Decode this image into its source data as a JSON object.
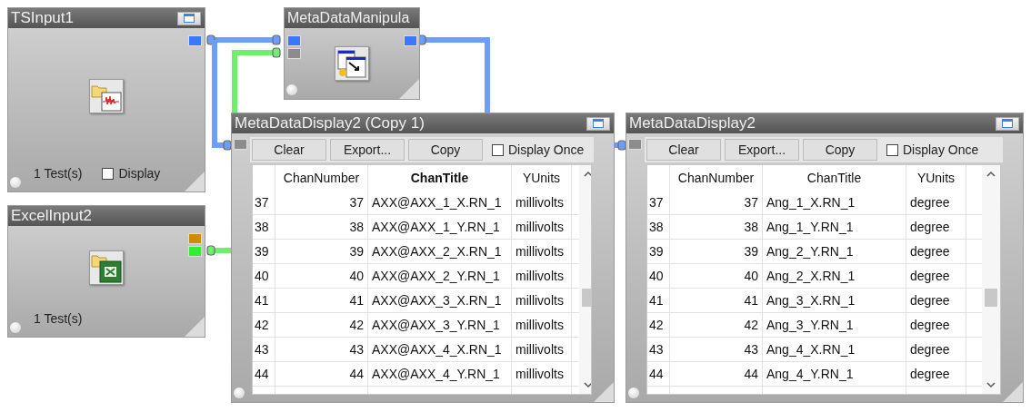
{
  "nodes": [
    {
      "kind": "input",
      "title": "TSInput1",
      "window_button": true,
      "outputs": [
        {
          "color": "#3a78ff"
        }
      ],
      "count": "1 Test(s)",
      "display": {
        "label": "Display",
        "checked": false
      }
    },
    {
      "kind": "manipulator",
      "title": "MetaDataManipula",
      "window_button": false,
      "inputs": [
        {
          "color": "#3a78ff"
        },
        {
          "color": "#8c8c8c"
        }
      ],
      "outputs": [
        {
          "color": "#3a78ff"
        }
      ]
    },
    {
      "kind": "input",
      "title": "ExcelInput2",
      "window_button": false,
      "outputs": [
        {
          "color": "#d08c00"
        },
        {
          "color": "#33ee33"
        }
      ],
      "count": "1 Test(s)"
    },
    {
      "kind": "display",
      "title": "MetaDataDisplay2 (Copy 1)",
      "window_button": true,
      "inputs": [
        {
          "color": "#8c8c8c"
        }
      ],
      "buttons": [
        "Clear",
        "Export...",
        "Copy"
      ],
      "display_once": {
        "label": "Display Once",
        "checked": false
      },
      "table": {
        "columns": [
          {
            "label": "ChanNumber",
            "selected": false
          },
          {
            "label": "ChanTitle",
            "selected": true
          },
          {
            "label": "YUnits",
            "selected": false
          }
        ],
        "rows": [
          {
            "index": "37",
            "cells": [
              "37",
              "AXX@AXX_1_X.RN_1",
              "millivolts"
            ]
          },
          {
            "index": "38",
            "cells": [
              "38",
              "AXX@AXX_1_Y.RN_1",
              "millivolts"
            ]
          },
          {
            "index": "39",
            "cells": [
              "39",
              "AXX@AXX_2_X.RN_1",
              "millivolts"
            ]
          },
          {
            "index": "40",
            "cells": [
              "40",
              "AXX@AXX_2_Y.RN_1",
              "millivolts"
            ]
          },
          {
            "index": "41",
            "cells": [
              "41",
              "AXX@AXX_3_X.RN_1",
              "millivolts"
            ]
          },
          {
            "index": "42",
            "cells": [
              "42",
              "AXX@AXX_3_Y.RN_1",
              "millivolts"
            ]
          },
          {
            "index": "43",
            "cells": [
              "43",
              "AXX@AXX_4_X.RN_1",
              "millivolts"
            ]
          },
          {
            "index": "44",
            "cells": [
              "44",
              "AXX@AXX_4_Y.RN_1",
              "millivolts"
            ]
          }
        ]
      }
    },
    {
      "kind": "display",
      "title": "MetaDataDisplay2",
      "window_button": true,
      "inputs": [
        {
          "color": "#8c8c8c"
        }
      ],
      "buttons": [
        "Clear",
        "Export...",
        "Copy"
      ],
      "display_once": {
        "label": "Display Once",
        "checked": false
      },
      "table": {
        "columns": [
          {
            "label": "ChanNumber",
            "selected": false
          },
          {
            "label": "ChanTitle",
            "selected": false
          },
          {
            "label": "YUnits",
            "selected": false
          }
        ],
        "rows": [
          {
            "index": "37",
            "cells": [
              "37",
              "Ang_1_X.RN_1",
              "degree"
            ]
          },
          {
            "index": "38",
            "cells": [
              "38",
              "Ang_1_Y.RN_1",
              "degree"
            ]
          },
          {
            "index": "39",
            "cells": [
              "39",
              "Ang_2_Y.RN_1",
              "degree"
            ]
          },
          {
            "index": "40",
            "cells": [
              "40",
              "Ang_2_X.RN_1",
              "degree"
            ]
          },
          {
            "index": "41",
            "cells": [
              "41",
              "Ang_3_X.RN_1",
              "degree"
            ]
          },
          {
            "index": "42",
            "cells": [
              "42",
              "Ang_3_Y.RN_1",
              "degree"
            ]
          },
          {
            "index": "43",
            "cells": [
              "43",
              "Ang_4_X.RN_1",
              "degree"
            ]
          },
          {
            "index": "44",
            "cells": [
              "44",
              "Ang_4_Y.RN_1",
              "degree"
            ]
          }
        ]
      }
    }
  ],
  "wires": [
    {
      "color": "#6f9cff"
    },
    {
      "color": "#6f9cff"
    },
    {
      "color": "#6ef06e"
    },
    {
      "color": "#6f9cff"
    }
  ]
}
